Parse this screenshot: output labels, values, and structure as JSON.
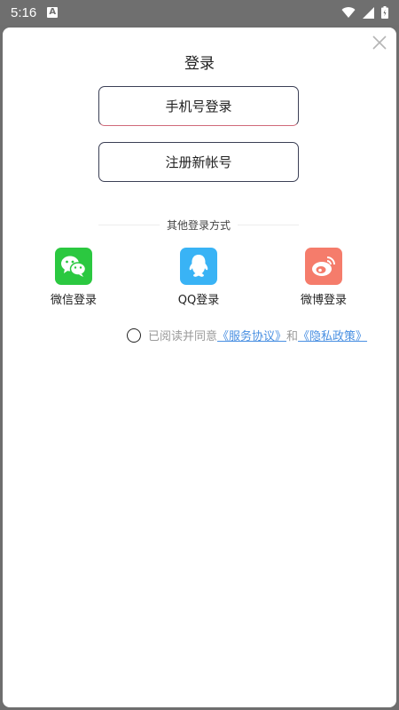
{
  "status_bar": {
    "time": "5:16",
    "notification_icon": "A"
  },
  "dialog": {
    "title": "登录",
    "phone_login_label": "手机号登录",
    "register_label": "注册新帐号",
    "other_methods_label": "其他登录方式",
    "social": [
      {
        "name": "wechat",
        "label": "微信登录",
        "color": "#2bc840"
      },
      {
        "name": "qq",
        "label": "QQ登录",
        "color": "#39b3f5"
      },
      {
        "name": "weibo",
        "label": "微博登录",
        "color": "#f57c6b"
      }
    ],
    "agreement": {
      "prefix": "已阅读并同意",
      "service_link": "《服务协议》",
      "and": "和",
      "privacy_link": "《隐私政策》"
    }
  },
  "colors": {
    "status_bar_bg": "#6f6f6f",
    "button_border": "#3b3f55",
    "link": "#4a90e2"
  }
}
